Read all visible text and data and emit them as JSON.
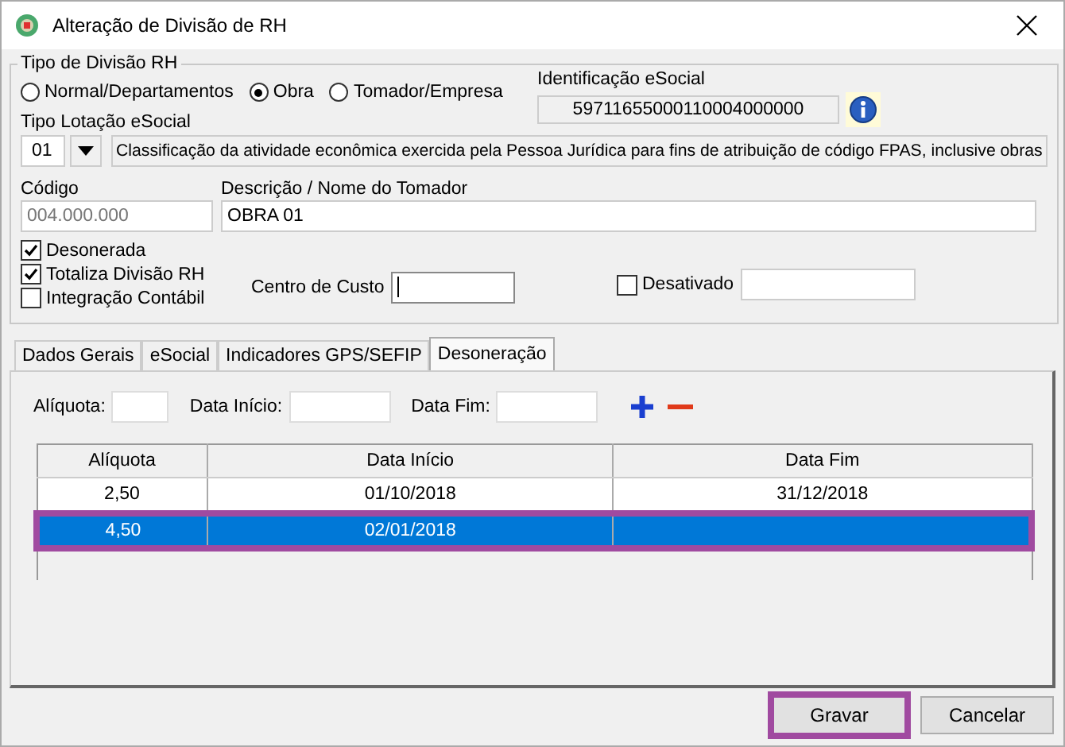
{
  "window": {
    "title": "Alteração de Divisão de RH"
  },
  "division_type": {
    "legend": "Tipo de Divisão RH",
    "options": [
      {
        "label": "Normal/Departamentos",
        "selected": false
      },
      {
        "label": "Obra",
        "selected": true
      },
      {
        "label": "Tomador/Empresa",
        "selected": false
      }
    ]
  },
  "esocial_id": {
    "label": "Identificação eSocial",
    "value": "59711655000110004000000"
  },
  "lotacao": {
    "label": "Tipo Lotação eSocial",
    "code": "01",
    "description": "Classificação da atividade econômica exercida pela Pessoa Jurídica para fins de atribuição de código FPAS, inclusive obras"
  },
  "codigo": {
    "label": "Código",
    "value": "004.000.000"
  },
  "descricao": {
    "label": "Descrição / Nome do Tomador",
    "value": "OBRA 01"
  },
  "checkboxes": [
    {
      "label": "Desonerada",
      "checked": true
    },
    {
      "label": "Totaliza Divisão RH",
      "checked": true
    },
    {
      "label": "Integração Contábil",
      "checked": false
    }
  ],
  "centro_custo": {
    "label": "Centro de Custo"
  },
  "desativado": {
    "label": "Desativado",
    "checked": false
  },
  "tabs": [
    {
      "label": "Dados Gerais",
      "selected": false
    },
    {
      "label": "eSocial",
      "selected": false
    },
    {
      "label": "Indicadores GPS/SEFIP",
      "selected": false
    },
    {
      "label": "Desoneração",
      "selected": true
    }
  ],
  "form_fields": [
    {
      "label": "Alíquota:"
    },
    {
      "label": "Data Início:"
    },
    {
      "label": "Data Fim:"
    }
  ],
  "table": {
    "columns": [
      "Alíquota",
      "Data Início",
      "Data Fim"
    ],
    "rows": [
      {
        "cells": [
          "2,50",
          "01/10/2018",
          "31/12/2018"
        ],
        "selected": false,
        "highlighted": false
      },
      {
        "cells": [
          "4,50",
          "02/01/2018",
          ""
        ],
        "selected": true,
        "highlighted": true
      }
    ]
  },
  "buttons": [
    {
      "label": "Gravar",
      "highlighted": true
    },
    {
      "label": "Cancelar",
      "highlighted": false
    }
  ]
}
